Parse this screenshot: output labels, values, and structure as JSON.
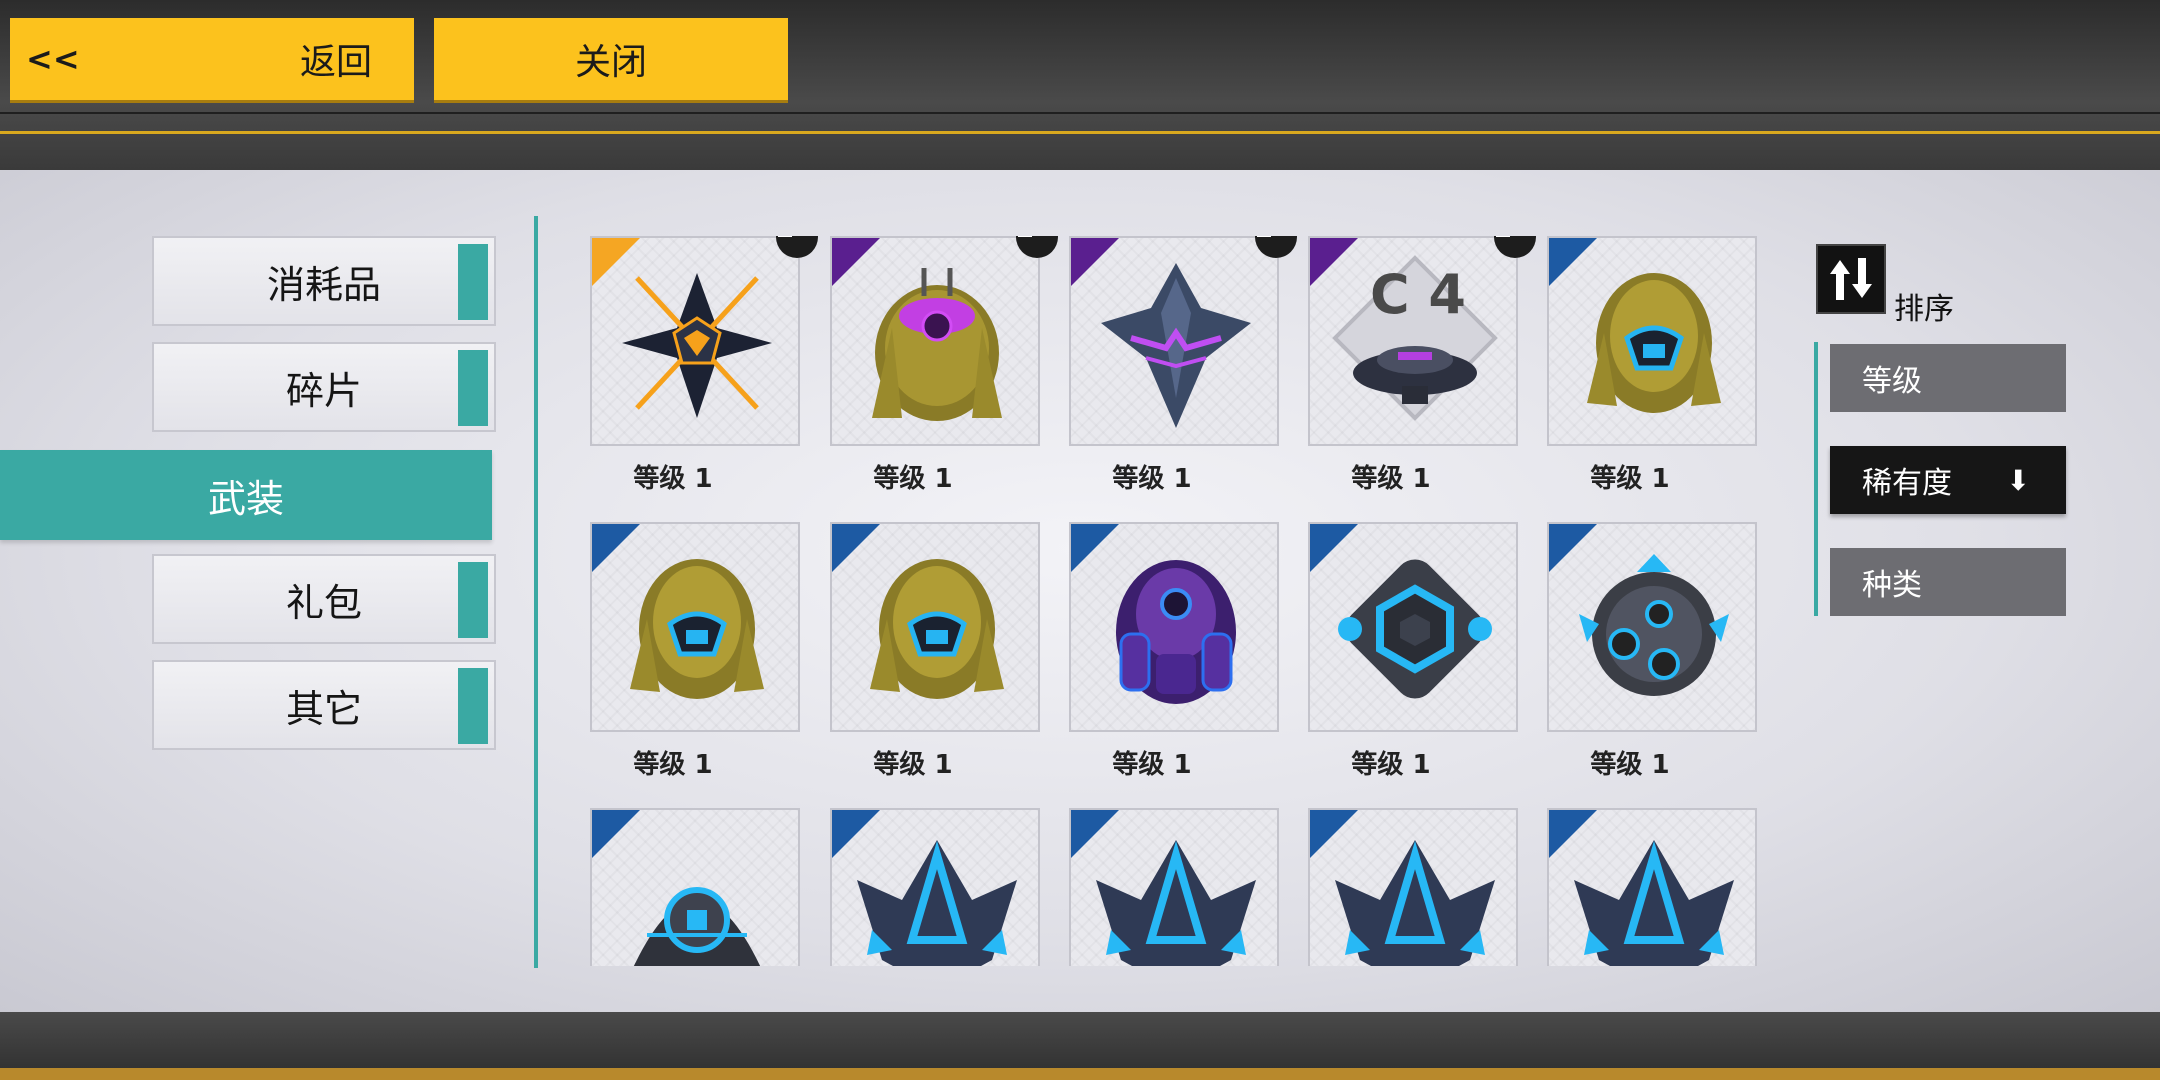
{
  "header": {
    "back_chevron": "<<",
    "back_label": "返回",
    "close_label": "关闭"
  },
  "categories": [
    {
      "label": "消耗品",
      "active": false
    },
    {
      "label": "碎片",
      "active": false
    },
    {
      "label": "武装",
      "active": true
    },
    {
      "label": "礼包",
      "active": false
    },
    {
      "label": "其它",
      "active": false
    }
  ],
  "items": [
    {
      "level": "等级 1",
      "rarity": "orange",
      "locked": true,
      "icon": "dark-star-orange-icon"
    },
    {
      "level": "等级 1",
      "rarity": "purple",
      "locked": true,
      "icon": "gold-pod-purple-core-icon"
    },
    {
      "level": "等级 1",
      "rarity": "purple",
      "locked": true,
      "icon": "dark-crystal-ship-icon"
    },
    {
      "level": "等级 1",
      "rarity": "purple",
      "locked": true,
      "icon": "c4-drone-icon"
    },
    {
      "level": "等级 1",
      "rarity": "blue",
      "locked": false,
      "icon": "gold-pod-blue-core-icon"
    },
    {
      "level": "等级 1",
      "rarity": "blue",
      "locked": false,
      "icon": "gold-pod-blue-core-icon"
    },
    {
      "level": "等级 1",
      "rarity": "blue",
      "locked": false,
      "icon": "gold-pod-blue-core-icon"
    },
    {
      "level": "等级 1",
      "rarity": "blue",
      "locked": false,
      "icon": "purple-pod-icon"
    },
    {
      "level": "等级 1",
      "rarity": "blue",
      "locked": false,
      "icon": "hex-core-drone-icon"
    },
    {
      "level": "等级 1",
      "rarity": "blue",
      "locked": false,
      "icon": "sphere-drone-icon"
    },
    {
      "level": "",
      "rarity": "blue",
      "locked": false,
      "icon": "dome-drone-icon"
    },
    {
      "level": "",
      "rarity": "blue",
      "locked": false,
      "icon": "blue-fighter-icon"
    },
    {
      "level": "",
      "rarity": "blue",
      "locked": false,
      "icon": "blue-fighter-icon"
    },
    {
      "level": "",
      "rarity": "blue",
      "locked": false,
      "icon": "blue-fighter-icon"
    },
    {
      "level": "",
      "rarity": "blue",
      "locked": false,
      "icon": "blue-fighter-icon"
    }
  ],
  "sort": {
    "label": "排序",
    "options": [
      {
        "label": "等级",
        "active": false,
        "arrow": ""
      },
      {
        "label": "稀有度",
        "active": true,
        "arrow": "⬇"
      },
      {
        "label": "种类",
        "active": false,
        "arrow": ""
      }
    ]
  },
  "colors": {
    "accent_yellow": "#fcc21d",
    "accent_teal": "#3aa9a3",
    "rarity_orange": "#f5a623",
    "rarity_purple": "#5a1f8f",
    "rarity_blue": "#1d5aa3"
  }
}
